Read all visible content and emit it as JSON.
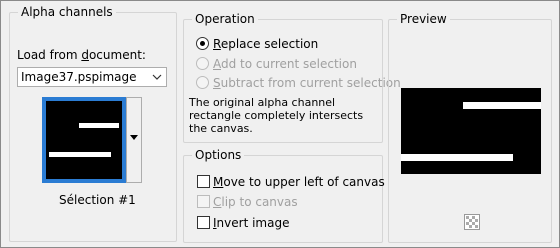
{
  "alpha_channels": {
    "title": "Alpha channels",
    "load_label_prefix": "Load from ",
    "load_label_accel": "d",
    "load_label_suffix": "ocument:",
    "document_value": "Image37.pspimage",
    "selection_name": "Sélection #1"
  },
  "operation": {
    "title": "Operation",
    "options": [
      {
        "accel": "R",
        "rest": "eplace selection",
        "selected": true,
        "enabled": true
      },
      {
        "accel": "A",
        "rest": "dd to current selection",
        "selected": false,
        "enabled": false
      },
      {
        "accel": "S",
        "rest": "ubtract from current selection",
        "selected": false,
        "enabled": false
      }
    ],
    "description": "The original alpha channel rectangle completely intersects the canvas."
  },
  "options": {
    "title": "Options",
    "items": [
      {
        "accel": "M",
        "rest": "ove to upper left of canvas",
        "checked": false,
        "enabled": true
      },
      {
        "accel": "C",
        "rest": "lip to canvas",
        "checked": false,
        "enabled": false
      },
      {
        "accel": "I",
        "rest": "nvert image",
        "checked": false,
        "enabled": true
      }
    ]
  },
  "preview": {
    "title": "Preview",
    "navigate_icon": "checkered-navigate-icon"
  }
}
